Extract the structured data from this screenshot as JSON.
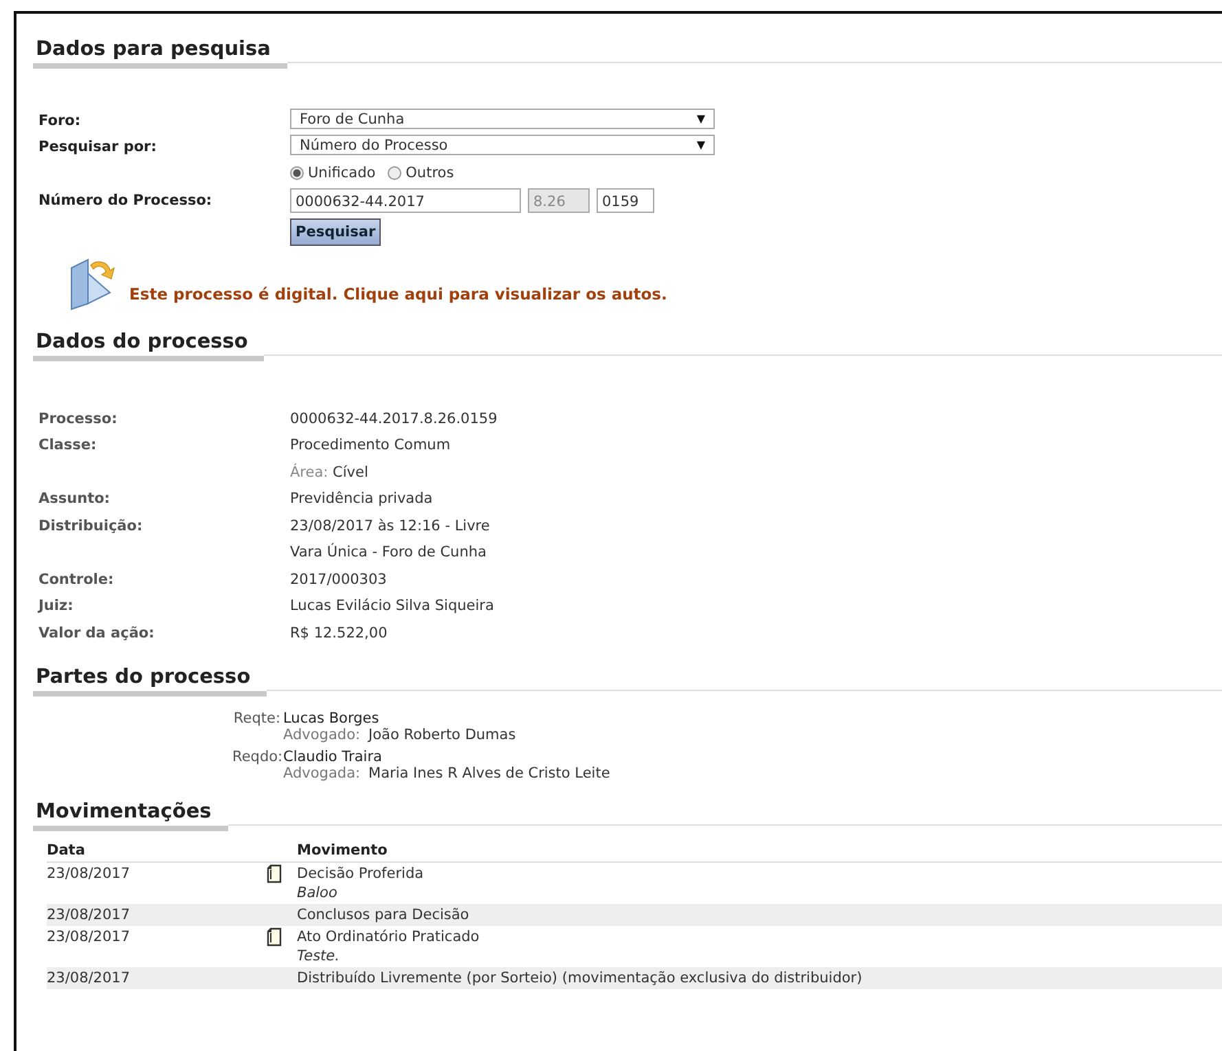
{
  "search_section": {
    "title": "Dados para pesquisa",
    "fields": [
      {
        "kind": "select",
        "label": "Foro:",
        "value": "Foro de Cunha",
        "arrow": "▼"
      },
      {
        "kind": "select",
        "label": "Pesquisar por:",
        "value": "Número do Processo",
        "arrow": "▼"
      }
    ],
    "radios": [
      {
        "label": "Unificado",
        "selected": true
      },
      {
        "label": "Outros",
        "selected": false
      }
    ],
    "number": {
      "label": "Número do Processo:",
      "parts": [
        {
          "value": "0000632-44.2017",
          "disabled": false
        },
        {
          "value": "8.26",
          "disabled": true
        },
        {
          "value": "0159",
          "disabled": false
        }
      ]
    },
    "button": "Pesquisar",
    "digital_notice": "Este processo é digital. Clique aqui para visualizar os autos."
  },
  "process_section": {
    "title": "Dados do processo",
    "rows": [
      {
        "label": "Processo:",
        "value": "0000632-44.2017.8.26.0159"
      },
      {
        "label": "Classe:",
        "value": "Procedimento Comum"
      },
      {
        "sublabel": "Área:",
        "value": "Cível"
      },
      {
        "label": "Assunto:",
        "value": "Previdência privada"
      },
      {
        "label": "Distribuição:",
        "value": "23/08/2017 às 12:16 - Livre"
      },
      {
        "value": "Vara Única - Foro de Cunha"
      },
      {
        "label": "Controle:",
        "value": "2017/000303"
      },
      {
        "label": "Juiz:",
        "value": "Lucas Evilácio Silva Siqueira"
      },
      {
        "label": "Valor da ação:",
        "value": "R$ 12.522,00"
      }
    ]
  },
  "parties_section": {
    "title": "Partes do processo",
    "parties": [
      {
        "role": "Reqte:",
        "name": "Lucas Borges",
        "lawyer_label": "Advogado:",
        "lawyer": "João Roberto Dumas"
      },
      {
        "role": "Reqdo:",
        "name": "Claudio Traira",
        "lawyer_label": "Advogada:",
        "lawyer": "Maria Ines R Alves de Cristo Leite"
      }
    ]
  },
  "movements_section": {
    "title": "Movimentações",
    "columns": [
      "Data",
      "Movimento"
    ],
    "rows": [
      {
        "date": "23/08/2017",
        "document": true,
        "text": "Decisão Proferida",
        "note": "Baloo"
      },
      {
        "date": "23/08/2017",
        "document": false,
        "text": "Conclusos para Decisão"
      },
      {
        "date": "23/08/2017",
        "document": true,
        "text": "Ato Ordinatório Praticado",
        "note": "Teste."
      },
      {
        "date": "23/08/2017",
        "document": false,
        "text": "Distribuído Livremente (por Sorteio) (movimentação exclusiva do distribuidor)"
      }
    ]
  }
}
